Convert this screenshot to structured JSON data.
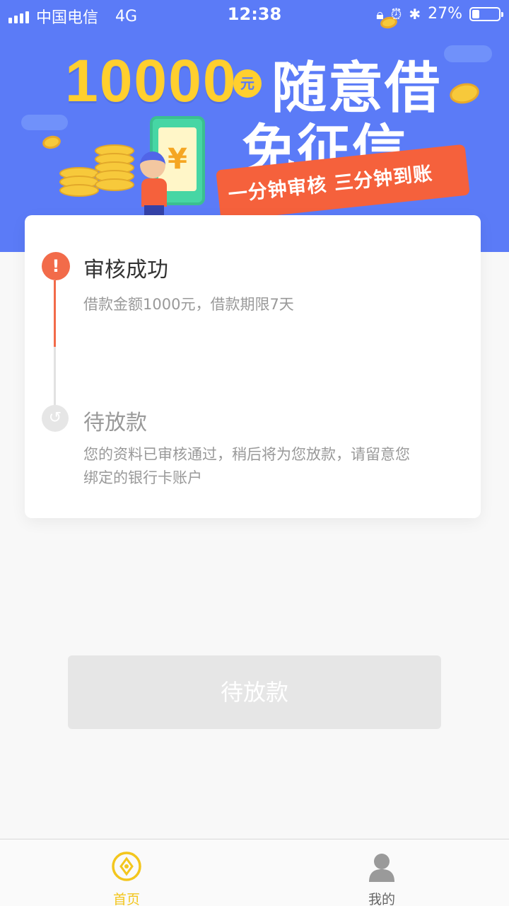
{
  "status_bar": {
    "carrier": "中国电信",
    "network": "4G",
    "time": "12:38",
    "battery_percent": "27%",
    "battery_level": 0.27
  },
  "banner": {
    "amount": "10000",
    "currency": "元",
    "headline": "随意借",
    "subheadline": "免征信",
    "ribbon_text": "一分钟审核 三分钟到账",
    "yen_symbol": "¥"
  },
  "progress": {
    "step1": {
      "title": "审核成功",
      "description": "借款金额1000元，借款期限7天",
      "icon": "exclamation-icon",
      "mark": "!"
    },
    "step2": {
      "title": "待放款",
      "description": "您的资料已审核通过，稍后将为您放款，请留意您绑定的银行卡账户",
      "icon": "refresh-icon"
    }
  },
  "action_button": {
    "label": "待放款"
  },
  "tabbar": {
    "home_label": "首页",
    "mine_label": "我的"
  },
  "colors": {
    "banner_blue": "#5b7bf7",
    "accent_yellow": "#f3c61d",
    "step_red": "#f26b4a"
  }
}
